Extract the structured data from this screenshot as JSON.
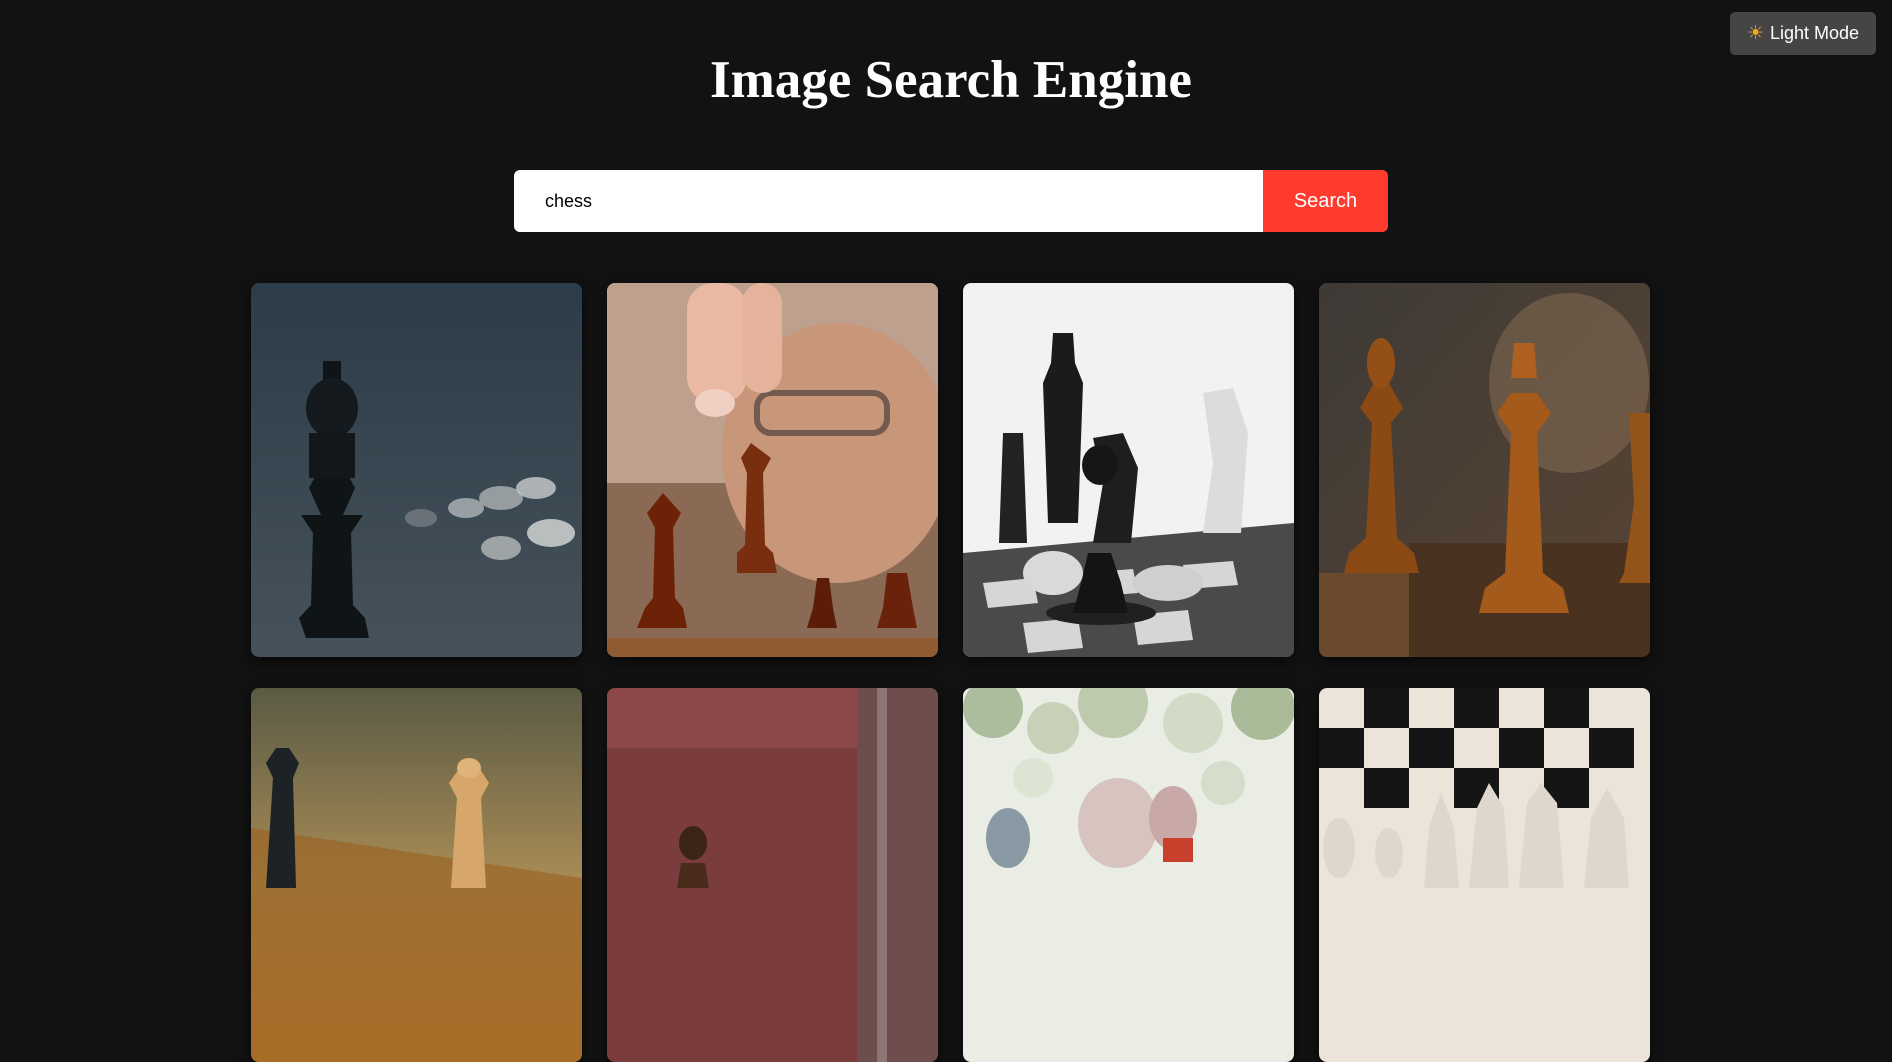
{
  "theme_toggle": {
    "icon": "sun-icon",
    "label": "Light Mode"
  },
  "header": {
    "title": "Image Search Engine"
  },
  "search": {
    "value": "chess",
    "button_label": "Search"
  },
  "results": [
    {
      "subject": "black chess king with fallen white pieces"
    },
    {
      "subject": "hand moving wooden chess piece, man in background"
    },
    {
      "subject": "black and white chess pieces on board"
    },
    {
      "subject": "wooden chess king and bishop close-up"
    },
    {
      "subject": "black and white kings on wooden board"
    },
    {
      "subject": "wooden chess piece against red background"
    },
    {
      "subject": "people playing chess outdoors"
    },
    {
      "subject": "ivory chess pieces on checkered board"
    }
  ],
  "colors": {
    "background": "#121212",
    "accent": "#ff3b2e",
    "toggle_bg": "#454545"
  }
}
